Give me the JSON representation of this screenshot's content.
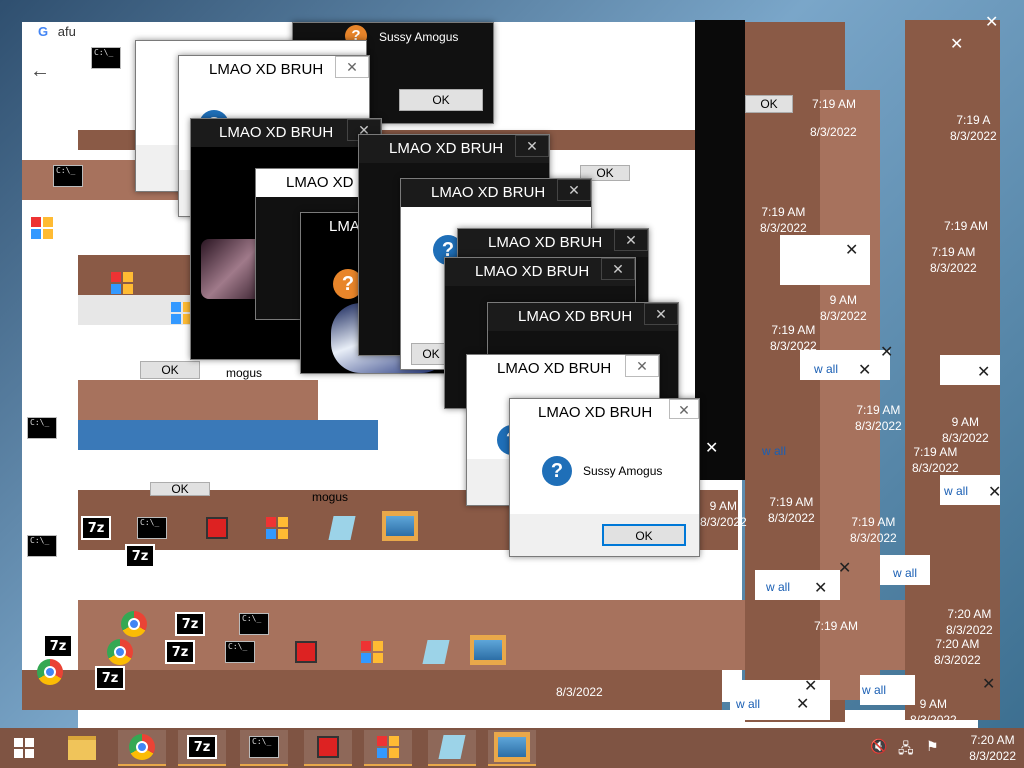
{
  "browser": {
    "tab_title": "afu",
    "search_letter": "G"
  },
  "dialogs": [
    {
      "title": "Sussy Amogus",
      "message": "",
      "ok": "OK"
    },
    {
      "title": "LMAO XD BRUH",
      "message": "",
      "ok": ""
    },
    {
      "title": "LMAO XD BRUH",
      "message": "",
      "ok": ""
    },
    {
      "title": "LMAO XD BRUH",
      "message": "",
      "ok": "OK"
    },
    {
      "title": "LMAO XD BRUH",
      "message": "",
      "ok": ""
    },
    {
      "title": "LMAO XD BRUH",
      "message": "",
      "ok": "OK"
    },
    {
      "title": "LMAO XD BRUH",
      "message": "",
      "ok": ""
    },
    {
      "title": "LMAO XD BRUH",
      "message": "",
      "ok": ""
    },
    {
      "title": "LMAO XD BRUH",
      "message": "",
      "ok": ""
    },
    {
      "title": "LMAO XD BRUH",
      "message": "",
      "ok": ""
    },
    {
      "title": "LMAO XD BRUH",
      "message": "Sussy Amogus",
      "ok": "OK"
    }
  ],
  "fragments": {
    "lmao_partial": "LMA",
    "amogus_partial": "mogus",
    "ok": "OK",
    "view_all": "w all"
  },
  "tray": {
    "time": "7:19 AM",
    "date": "8/3/2022",
    "time2": "7:20 AM",
    "partial_time": "9 AM",
    "partial_time2": "7:19 A"
  },
  "taskbar": {
    "sevenzip_label": "7z",
    "cmd_label": "C:\\_",
    "clock_time": "7:20 AM",
    "clock_date": "8/3/2022"
  },
  "colors": {
    "accent_brown": "#8a5a46",
    "dialog_blue_icon": "#1f6fb8",
    "dialog_orange_icon": "#e8852a"
  }
}
